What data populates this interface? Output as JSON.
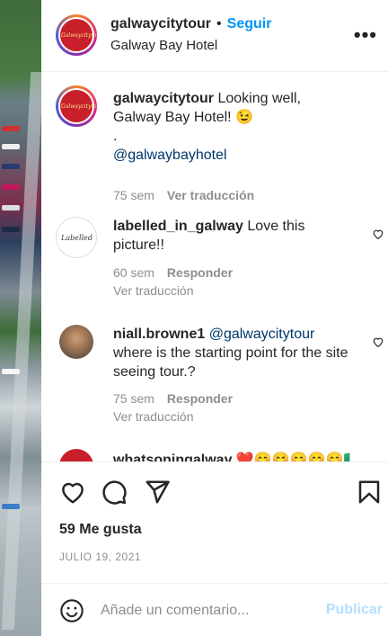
{
  "post": {
    "username": "galwaycitytour",
    "separator": "•",
    "follow_label": "Seguir",
    "location": "Galway Bay Hotel",
    "avatar_text": "Galwaycitytour",
    "more_icon": "more-options-icon"
  },
  "comments": [
    {
      "username": "galwaycitytour",
      "avatar_text": "Galwaycitytour",
      "text": "Looking well, Galway Bay Hotel! 😉",
      "extra_line": ".",
      "mention": "@galwaybayhotel",
      "time": "75 sem",
      "translate": "Ver traducción"
    },
    {
      "username": "labelled_in_galway",
      "avatar_text": "Labelled",
      "text": "Love this picture!!",
      "time": "60 sem",
      "reply": "Responder",
      "translate": "Ver traducción"
    },
    {
      "username": "niall.browne1",
      "mention": "@galwaycitytour",
      "text": "where is the starting point for the site seeing tour.?",
      "time": "75 sem",
      "reply": "Responder",
      "translate": "Ver traducción"
    },
    {
      "username": "whatsoningalway",
      "text": "❤️😊😊😊😊😊🇮🇪"
    }
  ],
  "actions": {
    "likes": "59 Me gusta",
    "date": "JULIO 19, 2021"
  },
  "composer": {
    "placeholder": "Añade un comentario...",
    "publish_label": "Publicar"
  }
}
